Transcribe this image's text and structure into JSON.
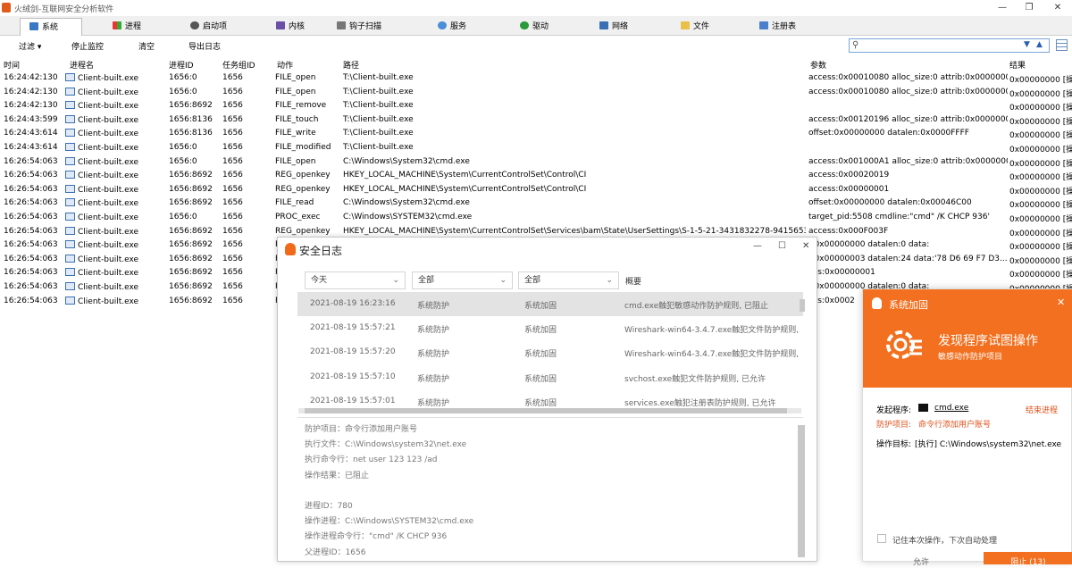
{
  "window": {
    "title": "火绒剑-互联网安全分析软件",
    "min": "—",
    "max": "❐",
    "close": "✕"
  },
  "tabs": [
    {
      "label": "系统",
      "icon": "system-icon",
      "active": true
    },
    {
      "label": "进程",
      "icon": "windows-flag-icon"
    },
    {
      "label": "启动项",
      "icon": "startup-icon"
    },
    {
      "label": "内核",
      "icon": "kernel-icon"
    },
    {
      "label": "钩子扫描",
      "icon": "hook-icon"
    },
    {
      "label": "服务",
      "icon": "service-icon"
    },
    {
      "label": "驱动",
      "icon": "driver-icon"
    },
    {
      "label": "网络",
      "icon": "network-icon"
    },
    {
      "label": "文件",
      "icon": "folder-icon"
    },
    {
      "label": "注册表",
      "icon": "registry-icon"
    }
  ],
  "toolbar": {
    "filter": "过滤",
    "stop": "停止监控",
    "clear": "清空",
    "export": "导出日志",
    "search_placeholder": ""
  },
  "columns": {
    "time": "时间",
    "proc": "进程名",
    "pid": "进程ID",
    "gid": "任务组ID",
    "action": "动作",
    "path": "路径",
    "params": "参数",
    "result": "结果"
  },
  "rows": [
    {
      "time": "16:24:42:130",
      "proc": "Client-built.exe",
      "pid": "1656:0",
      "gid": "1656",
      "action": "FILE_open",
      "path": "T:\\Client-built.exe",
      "params": "access:0x00010080 alloc_size:0 attrib:0x00000000...",
      "result": "0x00000000 [操作"
    },
    {
      "time": "16:24:42:130",
      "proc": "Client-built.exe",
      "pid": "1656:0",
      "gid": "1656",
      "action": "FILE_open",
      "path": "T:\\Client-built.exe",
      "params": "access:0x00010080 alloc_size:0 attrib:0x00000000...",
      "result": "0x00000000 [操作"
    },
    {
      "time": "16:24:42:130",
      "proc": "Client-built.exe",
      "pid": "1656:8692",
      "gid": "1656",
      "action": "FILE_remove",
      "path": "T:\\Client-built.exe",
      "params": "",
      "result": "0x00000000 [操作"
    },
    {
      "time": "16:24:43:599",
      "proc": "Client-built.exe",
      "pid": "1656:8136",
      "gid": "1656",
      "action": "FILE_touch",
      "path": "T:\\Client-built.exe",
      "params": "access:0x00120196 alloc_size:0 attrib:0x00000000...",
      "result": "0x00000000 [操作"
    },
    {
      "time": "16:24:43:614",
      "proc": "Client-built.exe",
      "pid": "1656:8136",
      "gid": "1656",
      "action": "FILE_write",
      "path": "T:\\Client-built.exe",
      "params": "offset:0x00000000 datalen:0x0000FFFF",
      "result": "0x00000000 [操作"
    },
    {
      "time": "16:24:43:614",
      "proc": "Client-built.exe",
      "pid": "1656:0",
      "gid": "1656",
      "action": "FILE_modified",
      "path": "T:\\Client-built.exe",
      "params": "",
      "result": "0x00000000 [操作"
    },
    {
      "time": "16:26:54:063",
      "proc": "Client-built.exe",
      "pid": "1656:0",
      "gid": "1656",
      "action": "FILE_open",
      "path": "C:\\Windows\\System32\\cmd.exe",
      "params": "access:0x001000A1 alloc_size:0 attrib:0x00000000...",
      "result": "0x00000000 [操作"
    },
    {
      "time": "16:26:54:063",
      "proc": "Client-built.exe",
      "pid": "1656:8692",
      "gid": "1656",
      "action": "REG_openkey",
      "path": "HKEY_LOCAL_MACHINE\\System\\CurrentControlSet\\Control\\CI",
      "params": "access:0x00020019",
      "result": "0x00000000 [操作"
    },
    {
      "time": "16:26:54:063",
      "proc": "Client-built.exe",
      "pid": "1656:8692",
      "gid": "1656",
      "action": "REG_openkey",
      "path": "HKEY_LOCAL_MACHINE\\System\\CurrentControlSet\\Control\\CI",
      "params": "access:0x00000001",
      "result": "0x00000000 [操作"
    },
    {
      "time": "16:26:54:063",
      "proc": "Client-built.exe",
      "pid": "1656:8692",
      "gid": "1656",
      "action": "FILE_read",
      "path": "C:\\Windows\\System32\\cmd.exe",
      "params": "offset:0x00000000 datalen:0x00046C00",
      "result": "0x00000000 [操作"
    },
    {
      "time": "16:26:54:063",
      "proc": "Client-built.exe",
      "pid": "1656:0",
      "gid": "1656",
      "action": "PROC_exec",
      "path": "C:\\Windows\\SYSTEM32\\cmd.exe",
      "params": "target_pid:5508 cmdline:\"cmd\" /K CHCP 936'",
      "result": "0x00000000 [操作"
    },
    {
      "time": "16:26:54:063",
      "proc": "Client-built.exe",
      "pid": "1656:8692",
      "gid": "1656",
      "action": "REG_openkey",
      "path": "HKEY_LOCAL_MACHINE\\System\\CurrentControlSet\\Services\\bam\\State\\UserSettings\\S-1-5-21-3431832278-941565366...",
      "params": "access:0x000F003F",
      "result": "0x00000000 [操作"
    },
    {
      "time": "16:26:54:063",
      "proc": "Client-built.exe",
      "pid": "1656:8692",
      "gid": "1656",
      "action": "R",
      "path": "",
      "params": "t:0x00000000 datalen:0 data:",
      "result": "0x00000000 [操作"
    },
    {
      "time": "16:26:54:063",
      "proc": "Client-built.exe",
      "pid": "1656:8692",
      "gid": "1656",
      "action": "R",
      "path": "",
      "params": "t:0x00000003 datalen:24 data:'78 D6 69 F7 D3...",
      "result": "0x00000000 [操作"
    },
    {
      "time": "16:26:54:063",
      "proc": "Client-built.exe",
      "pid": "1656:8692",
      "gid": "1656",
      "action": "R",
      "path": "",
      "params": "ess:0x00000001",
      "result": "0x00000000 [操作"
    },
    {
      "time": "16:26:54:063",
      "proc": "Client-built.exe",
      "pid": "1656:8692",
      "gid": "1656",
      "action": "R",
      "path": "",
      "params": "t:0x00000000 datalen:0 data:",
      "result": "0x00000000 [操作"
    },
    {
      "time": "16:26:54:063",
      "proc": "Client-built.exe",
      "pid": "1656:8692",
      "gid": "1656",
      "action": "R",
      "path": "",
      "params": "ess:0x0002",
      "result": ""
    }
  ],
  "dialog": {
    "title": "安全日志",
    "min": "—",
    "max": "☐",
    "close": "✕",
    "filter_date": "今天",
    "filter_type": "全部",
    "filter_sub": "全部",
    "summary_header": "概要",
    "rows": [
      {
        "time": "2021-08-19 16:23:16",
        "type": "系统防护",
        "sub": "系统加固",
        "summary": "cmd.exe触犯敏感动作防护规则, 已阻止",
        "selected": true
      },
      {
        "time": "2021-08-19 15:57:21",
        "type": "系统防护",
        "sub": "系统加固",
        "summary": "Wireshark-win64-3.4.7.exe触犯文件防护规则, 已"
      },
      {
        "time": "2021-08-19 15:57:20",
        "type": "系统防护",
        "sub": "系统加固",
        "summary": "Wireshark-win64-3.4.7.exe触犯文件防护规则, 已"
      },
      {
        "time": "2021-08-19 15:57:10",
        "type": "系统防护",
        "sub": "系统加固",
        "summary": "svchost.exe触犯文件防护规则, 已允许"
      },
      {
        "time": "2021-08-19 15:57:01",
        "type": "系统防护",
        "sub": "系统加固",
        "summary": "services.exe触犯注册表防护规则, 已允许"
      }
    ],
    "details": [
      "防护项目：命令行添加用户账号",
      "执行文件：C:\\Windows\\system32\\net.exe",
      "执行命令行：net  user 123 123 /ad",
      "操作结果：已阻止",
      "",
      "进程ID：780",
      "操作进程：C:\\Windows\\SYSTEM32\\cmd.exe",
      "操作进程命令行：\"cmd\" /K CHCP 936",
      "父进程ID：1656"
    ]
  },
  "popup": {
    "title": "系统加固",
    "close": "✕",
    "headline": "发现程序试图操作",
    "subhead": "敏感动作防护项目",
    "initiator_label": "发起程序:",
    "initiator_value": "cmd.exe",
    "end_process": "结束进程",
    "item_label": "防护项目:",
    "item_value": "命令行添加用户账号",
    "target_label": "操作目标:",
    "target_value": "[执行] C:\\Windows\\system32\\net.exe",
    "remember": "记住本次操作，下次自动处理",
    "btn_allow": "允许",
    "btn_block": "阻止 (13)"
  },
  "colors": {
    "accent": "#f2701f",
    "popup_header": "#f2701f",
    "link": "#e0501a"
  }
}
